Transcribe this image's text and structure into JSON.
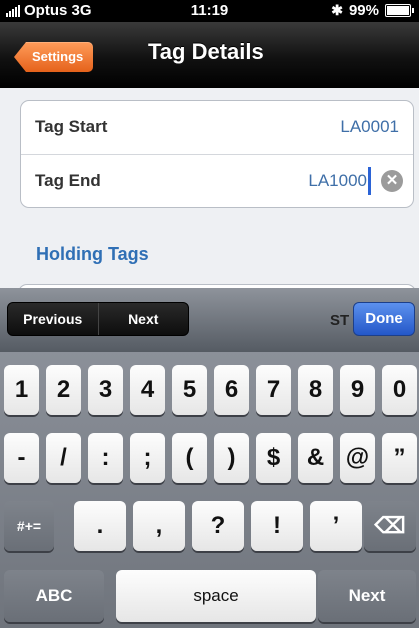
{
  "status_bar": {
    "carrier": "Optus",
    "network": "3G",
    "time": "11:19",
    "battery": "99%",
    "icons": [
      "signal-icon",
      "bluetooth-icon",
      "battery-icon"
    ]
  },
  "nav": {
    "back_label": "Settings",
    "title": "Tag Details",
    "back_color": "#e5621b"
  },
  "form": {
    "rows": [
      {
        "label": "Tag Start",
        "value": "LA0001"
      },
      {
        "label": "Tag End",
        "value": "LA1000"
      }
    ]
  },
  "section": {
    "header": "Holding Tags"
  },
  "toolbar": {
    "previous_label": "Previous",
    "next_label": "Next",
    "partial_text": "ST",
    "done_label": "Done"
  },
  "keyboard": {
    "row1": [
      "1",
      "2",
      "3",
      "4",
      "5",
      "6",
      "7",
      "8",
      "9",
      "0"
    ],
    "row2": [
      "-",
      "/",
      ":",
      ";",
      "(",
      ")",
      "$",
      "&",
      "@",
      "”"
    ],
    "row3": {
      "mode_label": "#+=",
      "keys": [
        ".",
        ",",
        "?",
        "!",
        "’"
      ],
      "delete_icon": "backspace-icon"
    },
    "row4": {
      "abc_label": "ABC",
      "space_label": "space",
      "next_label": "Next"
    }
  }
}
